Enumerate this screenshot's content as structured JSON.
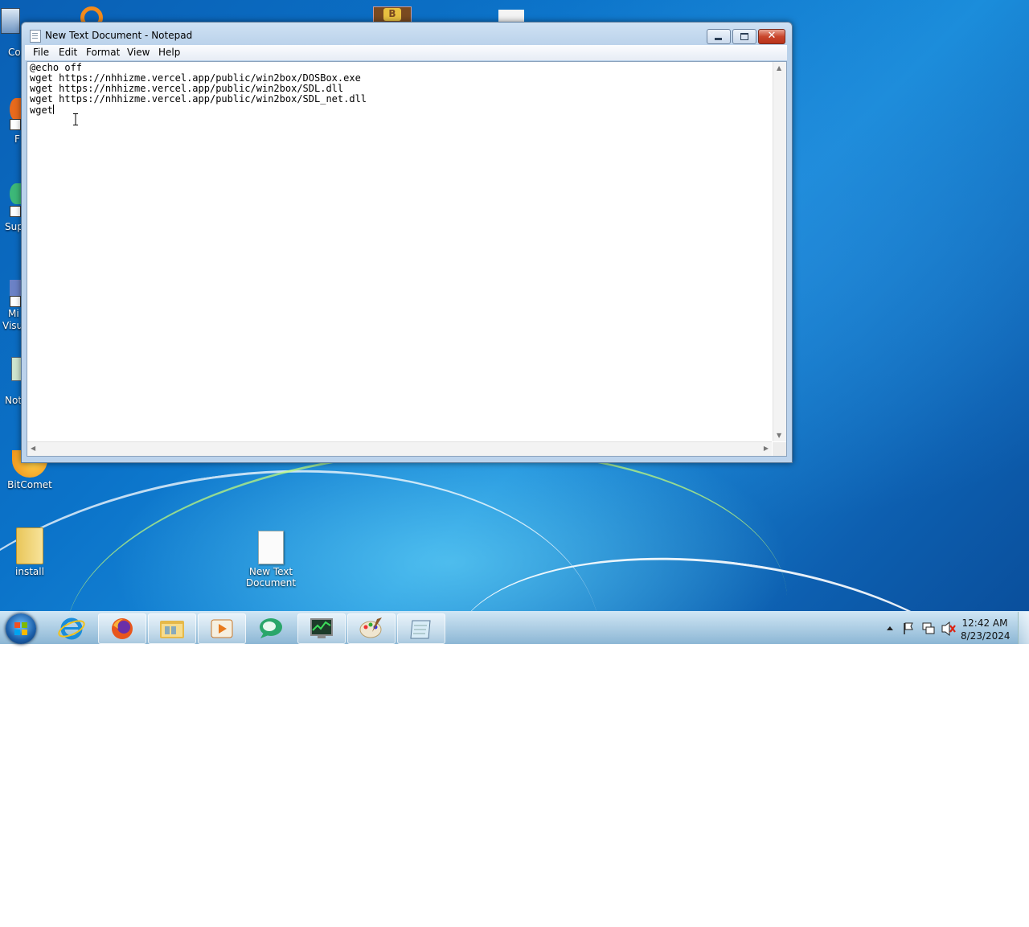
{
  "desktop": {
    "icons": [
      {
        "label": "Co",
        "icon": "computer-icon"
      },
      {
        "label": "F",
        "icon": "firefox-shortcut-icon"
      },
      {
        "label": "Sup",
        "icon": "shortcut-icon"
      },
      {
        "label": "Mi",
        "label2": "Visu",
        "icon": "shortcut-icon"
      },
      {
        "label": "Not",
        "icon": "notepad-shortcut-icon"
      },
      {
        "label": "BitComet",
        "icon": "bitcomet-icon"
      },
      {
        "label": "install",
        "icon": "folder-icon"
      },
      {
        "label": "New Text",
        "label2": "Document",
        "icon": "text-file-icon"
      }
    ]
  },
  "window": {
    "title": "New Text Document - Notepad",
    "menu": [
      "File",
      "Edit",
      "Format",
      "View",
      "Help"
    ],
    "content_lines": [
      "@echo off",
      "wget https://nhhizme.vercel.app/public/win2box/DOSBox.exe",
      "wget https://nhhizme.vercel.app/public/win2box/SDL.dll",
      "wget https://nhhizme.vercel.app/public/win2box/SDL_net.dll",
      "wget"
    ]
  },
  "taskbar": {
    "buttons": [
      {
        "name": "internet-explorer",
        "icon": "ie-icon",
        "active": false
      },
      {
        "name": "firefox",
        "icon": "firefox-icon",
        "active": true
      },
      {
        "name": "explorer",
        "icon": "folder-icon",
        "active": true
      },
      {
        "name": "media-player",
        "icon": "media-player-icon",
        "active": true
      },
      {
        "name": "app",
        "icon": "green-app-icon",
        "active": false
      },
      {
        "name": "task-manager",
        "icon": "monitor-icon",
        "active": true
      },
      {
        "name": "paint",
        "icon": "paint-icon",
        "active": true
      },
      {
        "name": "notepad",
        "icon": "notepad-icon",
        "active": true
      }
    ],
    "clock": {
      "time": "12:42 AM",
      "date": "8/23/2024"
    }
  }
}
